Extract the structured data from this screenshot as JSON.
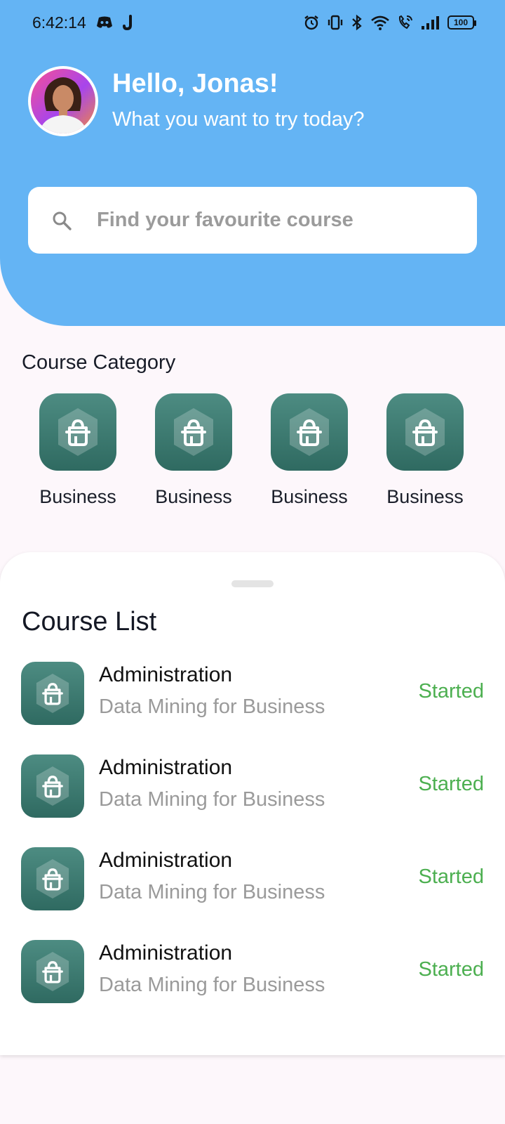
{
  "status_bar": {
    "time": "6:42:14",
    "battery": "100",
    "left_icons": [
      "discord-icon",
      "j-app-icon"
    ],
    "right_icons": [
      "alarm-icon",
      "vibrate-icon",
      "bluetooth-icon",
      "wifi-icon",
      "wifi-calling-icon",
      "signal-icon",
      "battery-icon"
    ]
  },
  "header": {
    "greeting": "Hello, Jonas!",
    "subtitle": "What you want to try today?",
    "search_placeholder": "Find your favourite course",
    "color": "#64b4f4"
  },
  "category": {
    "title": "Course Category",
    "items": [
      {
        "label": "Business",
        "icon": "basket-icon"
      },
      {
        "label": "Business",
        "icon": "basket-icon"
      },
      {
        "label": "Business",
        "icon": "basket-icon"
      },
      {
        "label": "Business",
        "icon": "basket-icon"
      }
    ]
  },
  "course_list": {
    "title": "Course List",
    "items": [
      {
        "title": "Administration",
        "subtitle": "Data Mining for Business",
        "status": "Started"
      },
      {
        "title": "Administration",
        "subtitle": "Data Mining for Business",
        "status": "Started"
      },
      {
        "title": "Administration",
        "subtitle": "Data Mining for Business",
        "status": "Started"
      },
      {
        "title": "Administration",
        "subtitle": "Data Mining for Business",
        "status": "Started"
      }
    ],
    "status_color": "#4caf50"
  }
}
